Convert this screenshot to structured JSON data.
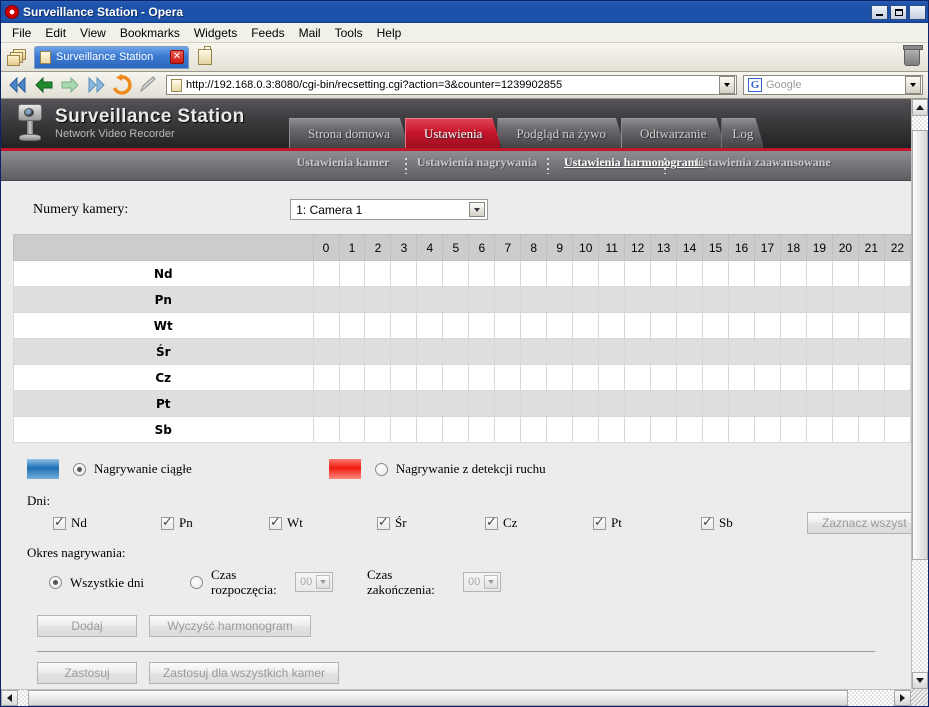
{
  "window": {
    "title": "Surveillance Station - Opera",
    "minimize_label": "Minimize",
    "maximize_label": "Maximize",
    "close_label": "✕"
  },
  "menubar": {
    "items": [
      "File",
      "Edit",
      "View",
      "Bookmarks",
      "Widgets",
      "Feeds",
      "Mail",
      "Tools",
      "Help"
    ]
  },
  "tabbar": {
    "tab_title": "Surveillance Station",
    "close_glyph": "✕"
  },
  "navbar": {
    "url": "http://192.168.0.3:8080/cgi-bin/recsetting.cgi?action=3&counter=1239902855",
    "search_placeholder": "Google",
    "search_engine_letter": "G"
  },
  "site": {
    "brand_title": "Surveillance Station",
    "brand_subtitle": "Network Video Recorder",
    "main_tabs": [
      {
        "label": "Strona domowa",
        "active": false
      },
      {
        "label": "Ustawienia",
        "active": true
      },
      {
        "label": "Podgląd na żywo",
        "active": false
      },
      {
        "label": "Odtwarzanie",
        "active": false
      },
      {
        "label": "Log",
        "active": false
      }
    ],
    "sub_nav": [
      {
        "label": "Ustawienia kamer",
        "active": false
      },
      {
        "label": "Ustawienia nagrywania",
        "active": false
      },
      {
        "label": "Ustawienia harmonogramu",
        "active": true
      },
      {
        "label": "Ustawienia zaawansowane",
        "active": false
      }
    ]
  },
  "form": {
    "camera_label": "Numery kamery:",
    "camera_value": "1: Camera 1",
    "days_label": "Dni:",
    "select_all_label": "Zaznacz wszyst",
    "period_label": "Okres nagrywania:",
    "all_days_label": "Wszystkie dni",
    "start_time_label": "Czas rozpoczęcia:",
    "start_time_value": "00",
    "end_time_label": "Czas zakończenia:",
    "end_time_value": "00",
    "add_label": "Dodaj",
    "clear_label": "Wyczyść harmonogram",
    "apply_label": "Zastosuj",
    "apply_all_label": "Zastosuj dla wszystkich kamer"
  },
  "legend": [
    {
      "label": "Nagrywanie ciągłe",
      "color": "#1f6fb5",
      "selected": true
    },
    {
      "label": "Nagrywanie z detekcji ruchu",
      "color": "#ee1b10",
      "selected": false
    }
  ],
  "schedule": {
    "hours": [
      "0",
      "1",
      "2",
      "3",
      "4",
      "5",
      "6",
      "7",
      "8",
      "9",
      "10",
      "11",
      "12",
      "13",
      "14",
      "15",
      "16",
      "17",
      "18",
      "19",
      "20",
      "21",
      "22"
    ],
    "days": [
      "Nd",
      "Pn",
      "Wt",
      "Śr",
      "Cz",
      "Pt",
      "Sb"
    ]
  },
  "day_checkboxes": [
    {
      "label": "Nd",
      "checked": true
    },
    {
      "label": "Pn",
      "checked": true
    },
    {
      "label": "Wt",
      "checked": true
    },
    {
      "label": "Śr",
      "checked": true
    },
    {
      "label": "Cz",
      "checked": true
    },
    {
      "label": "Pt",
      "checked": true
    },
    {
      "label": "Sb",
      "checked": true
    }
  ]
}
